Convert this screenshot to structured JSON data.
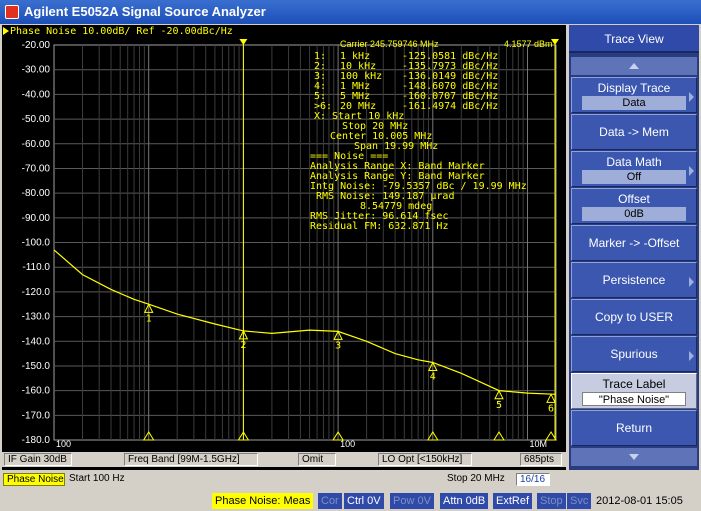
{
  "window": {
    "title": "Agilent E5052A Signal Source Analyzer"
  },
  "trace": {
    "header": "Phase Noise 10.00dB/ Ref -20.00dBc/Hz",
    "carrier_label": "Carrier 245.759746 MHz",
    "carrier_power": "4.1577 dBm"
  },
  "markers": [
    {
      "num": "1:",
      "freq": "1 kHz",
      "val": "-125.0581 dBc/Hz"
    },
    {
      "num": "2:",
      "freq": "10 kHz",
      "val": "-135.7973 dBc/Hz"
    },
    {
      "num": "3:",
      "freq": "100 kHz",
      "val": "-136.0149 dBc/Hz"
    },
    {
      "num": "4:",
      "freq": "1 MHz",
      "val": "-148.6070 dBc/Hz"
    },
    {
      "num": "5:",
      "freq": "5 MHz",
      "val": "-160.0707 dBc/Hz"
    },
    {
      "num": ">6:",
      "freq": "20 MHz",
      "val": "-161.4974 dBc/Hz"
    }
  ],
  "span_info": {
    "x_start": "X: Start 10 kHz",
    "stop": "Stop 20 MHz",
    "center": "Center 10.005 MHz",
    "span": "Span 19.99 MHz"
  },
  "noise_info": {
    "header": "=== Noise ===",
    "range_x": "Analysis Range X: Band Marker",
    "range_y": "Analysis Range Y: Band Marker",
    "intg": "Intg Noise: -79.5357 dBc / 19.99 MHz",
    "rms_noise": "RMS Noise: 149.187 µrad",
    "rms_deg": "8.54779 mdeg",
    "jitter": "RMS Jitter: 96.614 fsec",
    "residual": "Residual FM: 632.871 Hz"
  },
  "chart_data": {
    "type": "line",
    "xscale": "log",
    "xlim": [
      100,
      20000000
    ],
    "ylim": [
      -180,
      -20
    ],
    "yticks": [
      "-20.00",
      "-30.00",
      "-40.00",
      "-50.00",
      "-60.00",
      "-70.00",
      "-80.00",
      "-90.00",
      "-100.0",
      "-110.0",
      "-120.0",
      "-130.0",
      "-140.0",
      "-150.0",
      "-160.0",
      "-170.0",
      "-180.0"
    ],
    "xtick_labels": [
      {
        "x": 100,
        "label": "100"
      },
      {
        "x": 100000,
        "label": "100"
      },
      {
        "x": 10000000,
        "label": "10M"
      }
    ],
    "grid": true,
    "series": [
      {
        "color": "#ffff00",
        "x": [
          100,
          200,
          400,
          700,
          1000,
          2000,
          5000,
          10000,
          20000,
          50000,
          100000,
          200000,
          400000,
          700000,
          1000000,
          2000000,
          5000000,
          10000000,
          20000000
        ],
        "y": [
          -103,
          -113,
          -119,
          -123,
          -125,
          -129,
          -133,
          -135.8,
          -136.8,
          -135.5,
          -136,
          -140,
          -145,
          -147.5,
          -148.6,
          -153,
          -160,
          -161,
          -161.5
        ]
      }
    ],
    "marker_points": [
      {
        "label": "1",
        "x": 1000,
        "y": -125.06
      },
      {
        "label": "2",
        "x": 10000,
        "y": -135.8
      },
      {
        "label": "3",
        "x": 100000,
        "y": -136.01
      },
      {
        "label": "4",
        "x": 1000000,
        "y": -148.61
      },
      {
        "label": "5",
        "x": 5000000,
        "y": -160.07
      },
      {
        "label": "6",
        "x": 20000000,
        "y": -161.5
      }
    ],
    "band_lines": [
      10000,
      20000000
    ]
  },
  "status_line1": {
    "if_gain": "IF Gain 30dB",
    "freq_band": "Freq Band [99M-1.5GHz]",
    "omit": "Omit",
    "lo_opt": "LO Opt [<150kHz]",
    "points": "685pts"
  },
  "status_line2": {
    "mode": "Phase Noise",
    "start": "Start 100 Hz",
    "stop": "Stop 20 MHz",
    "count": "16/16"
  },
  "softkeys": {
    "title": "Trace View",
    "display_trace": {
      "label": "Display Trace",
      "value": "Data"
    },
    "data_mem": "Data -> Mem",
    "data_math": {
      "label": "Data Math",
      "value": "Off"
    },
    "offset": {
      "label": "Offset",
      "value": "0dB"
    },
    "marker_offset": "Marker -> -Offset",
    "persistence": "Persistence",
    "copy_user": "Copy to USER",
    "spurious": "Spurious",
    "trace_label": {
      "label": "Trace Label",
      "value": "\"Phase Noise\""
    },
    "return": "Return"
  },
  "bottom_status": {
    "meas": "Phase Noise: Meas",
    "cor": "Cor",
    "ctrl": "Ctrl 0V",
    "pow": "Pow 0V",
    "attn": "Attn 0dB",
    "extref": "ExtRef",
    "stop": "Stop",
    "svc": "Svc",
    "datetime": "2012-08-01 15:05"
  }
}
